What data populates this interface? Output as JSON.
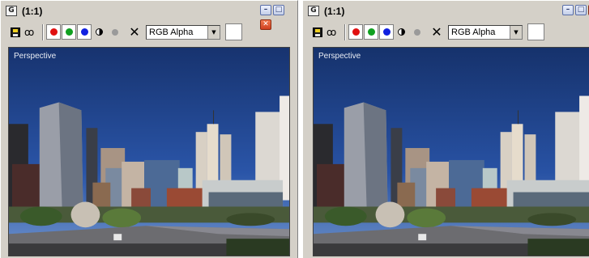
{
  "windows": [
    {
      "title": "(1:1)",
      "toolbar": {
        "channel_display": "RGB Alpha"
      },
      "viewport_label": "Perspective"
    },
    {
      "title": "(1:1)",
      "toolbar": {
        "channel_display": "RGB Alpha"
      },
      "viewport_label": "Perspective"
    }
  ],
  "colors": {
    "red_channel": "#e01010",
    "green_channel": "#10a020",
    "blue_channel": "#1020e0",
    "chrome": "#d4d0c8",
    "sky": "#1e3f86"
  },
  "icons": {
    "app": "app-icon",
    "save": "save-icon",
    "clone": "clone-icon",
    "clear": "close-icon"
  }
}
